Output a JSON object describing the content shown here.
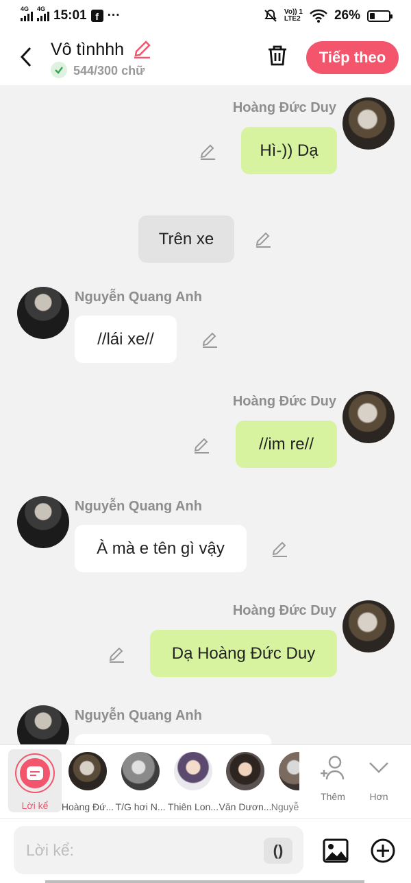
{
  "status_bar": {
    "time": "15:01",
    "network_1": "4G",
    "network_2": "4G",
    "app_icon": "f",
    "more": "···",
    "volte_top": "Vo)) 1",
    "volte_bottom": "LTE2",
    "battery_percent": "26%",
    "battery_level": 0.26
  },
  "header": {
    "title": "Vô tìnhhh",
    "word_count": "544/300 chữ",
    "next_button": "Tiếp theo"
  },
  "messages": [
    {
      "speaker": "Hoàng Đức Duy",
      "text": "Hì-)) Dạ",
      "side": "right"
    },
    {
      "speaker": "",
      "text": "Trên xe",
      "side": "center"
    },
    {
      "speaker": "Nguyễn Quang Anh",
      "text": "//lái xe//",
      "side": "left"
    },
    {
      "speaker": "Hoàng Đức Duy",
      "text": "//im re//",
      "side": "right"
    },
    {
      "speaker": "Nguyễn Quang Anh",
      "text": "À mà e tên gì vậy",
      "side": "left"
    },
    {
      "speaker": "Hoàng Đức Duy",
      "text": "Dạ Hoàng Đức Duy",
      "side": "right"
    },
    {
      "speaker": "Nguyễn Quang Anh",
      "text": "",
      "side": "left"
    }
  ],
  "characters": {
    "narrator": "Lời kể",
    "list": [
      "Hoàng Đứ...",
      "T/G hơi N...",
      "Thiên Lon...",
      "Văn Dươn...",
      "Nguyễ"
    ],
    "add": "Thêm",
    "more": "Hơn"
  },
  "composer": {
    "placeholder": "Lời kể:",
    "paren_button": "()"
  }
}
